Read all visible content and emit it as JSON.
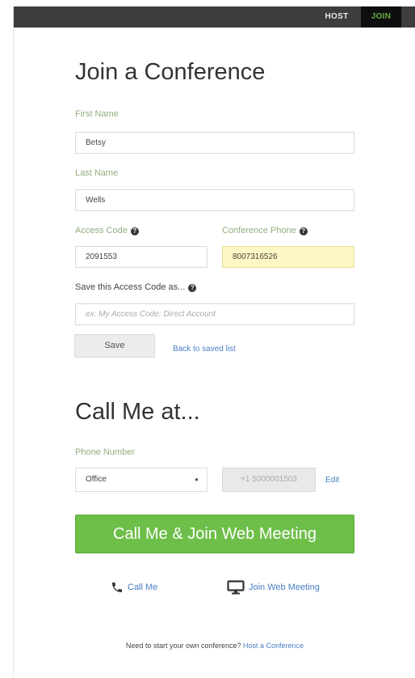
{
  "topbar": {
    "host_tab": "HOST",
    "join_tab": "JOIN"
  },
  "join": {
    "title": "Join a Conference",
    "first_name": {
      "label": "First Name",
      "value": "Betsy"
    },
    "last_name": {
      "label": "Last Name",
      "value": "Wells"
    },
    "access_code": {
      "label": "Access Code",
      "value": "2091553"
    },
    "conference_phone": {
      "label": "Conference Phone",
      "value": "8007316526"
    },
    "save_as": {
      "label": "Save this Access Code as...",
      "placeholder": "ex: My Access Code: Direct Account"
    },
    "save_button": "Save",
    "back_link": "Back to saved list"
  },
  "call_me": {
    "title": "Call Me at...",
    "phone_label": "Phone Number",
    "phone_type_selected": "Office",
    "phone_value": "+1 5000001503",
    "edit_link": "Edit",
    "join_button": "Call Me & Join Web Meeting",
    "call_me_link": "Call Me",
    "join_web_link": "Join Web Meeting"
  },
  "footer": {
    "text": "Need to start your own conference?",
    "link": "Host a Conference"
  },
  "colors": {
    "accent_green": "#6ebe4a",
    "link_blue": "#4a7fc4",
    "topbar": "#3d3d3d"
  }
}
